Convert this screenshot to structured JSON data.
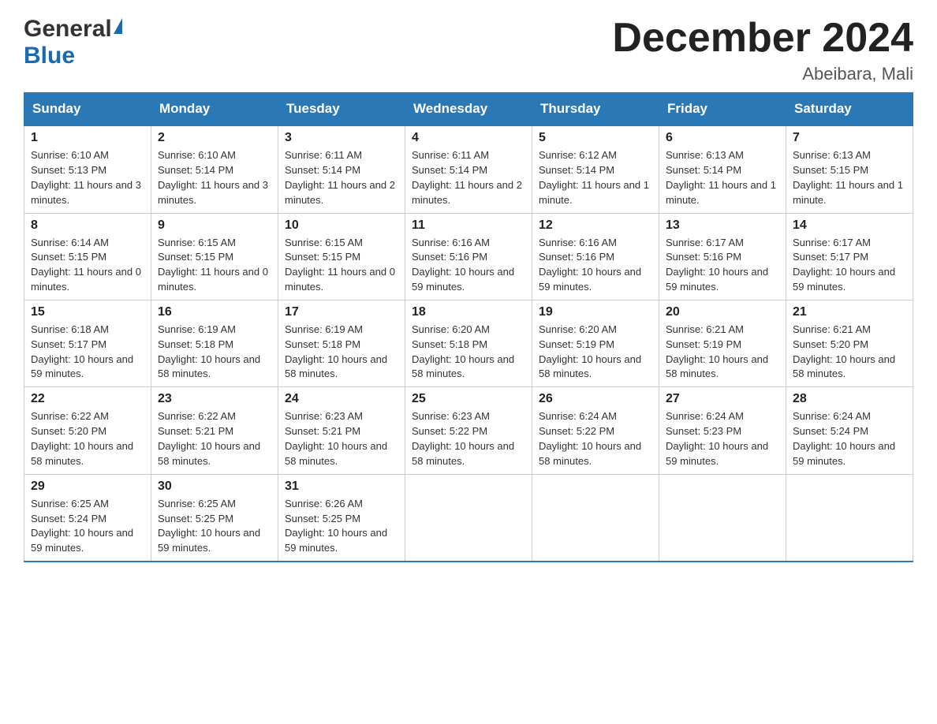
{
  "header": {
    "logo_general": "General",
    "logo_blue": "Blue",
    "month_title": "December 2024",
    "location": "Abeibara, Mali"
  },
  "columns": [
    "Sunday",
    "Monday",
    "Tuesday",
    "Wednesday",
    "Thursday",
    "Friday",
    "Saturday"
  ],
  "weeks": [
    [
      {
        "day": "1",
        "sunrise": "Sunrise: 6:10 AM",
        "sunset": "Sunset: 5:13 PM",
        "daylight": "Daylight: 11 hours and 3 minutes."
      },
      {
        "day": "2",
        "sunrise": "Sunrise: 6:10 AM",
        "sunset": "Sunset: 5:14 PM",
        "daylight": "Daylight: 11 hours and 3 minutes."
      },
      {
        "day": "3",
        "sunrise": "Sunrise: 6:11 AM",
        "sunset": "Sunset: 5:14 PM",
        "daylight": "Daylight: 11 hours and 2 minutes."
      },
      {
        "day": "4",
        "sunrise": "Sunrise: 6:11 AM",
        "sunset": "Sunset: 5:14 PM",
        "daylight": "Daylight: 11 hours and 2 minutes."
      },
      {
        "day": "5",
        "sunrise": "Sunrise: 6:12 AM",
        "sunset": "Sunset: 5:14 PM",
        "daylight": "Daylight: 11 hours and 1 minute."
      },
      {
        "day": "6",
        "sunrise": "Sunrise: 6:13 AM",
        "sunset": "Sunset: 5:14 PM",
        "daylight": "Daylight: 11 hours and 1 minute."
      },
      {
        "day": "7",
        "sunrise": "Sunrise: 6:13 AM",
        "sunset": "Sunset: 5:15 PM",
        "daylight": "Daylight: 11 hours and 1 minute."
      }
    ],
    [
      {
        "day": "8",
        "sunrise": "Sunrise: 6:14 AM",
        "sunset": "Sunset: 5:15 PM",
        "daylight": "Daylight: 11 hours and 0 minutes."
      },
      {
        "day": "9",
        "sunrise": "Sunrise: 6:15 AM",
        "sunset": "Sunset: 5:15 PM",
        "daylight": "Daylight: 11 hours and 0 minutes."
      },
      {
        "day": "10",
        "sunrise": "Sunrise: 6:15 AM",
        "sunset": "Sunset: 5:15 PM",
        "daylight": "Daylight: 11 hours and 0 minutes."
      },
      {
        "day": "11",
        "sunrise": "Sunrise: 6:16 AM",
        "sunset": "Sunset: 5:16 PM",
        "daylight": "Daylight: 10 hours and 59 minutes."
      },
      {
        "day": "12",
        "sunrise": "Sunrise: 6:16 AM",
        "sunset": "Sunset: 5:16 PM",
        "daylight": "Daylight: 10 hours and 59 minutes."
      },
      {
        "day": "13",
        "sunrise": "Sunrise: 6:17 AM",
        "sunset": "Sunset: 5:16 PM",
        "daylight": "Daylight: 10 hours and 59 minutes."
      },
      {
        "day": "14",
        "sunrise": "Sunrise: 6:17 AM",
        "sunset": "Sunset: 5:17 PM",
        "daylight": "Daylight: 10 hours and 59 minutes."
      }
    ],
    [
      {
        "day": "15",
        "sunrise": "Sunrise: 6:18 AM",
        "sunset": "Sunset: 5:17 PM",
        "daylight": "Daylight: 10 hours and 59 minutes."
      },
      {
        "day": "16",
        "sunrise": "Sunrise: 6:19 AM",
        "sunset": "Sunset: 5:18 PM",
        "daylight": "Daylight: 10 hours and 58 minutes."
      },
      {
        "day": "17",
        "sunrise": "Sunrise: 6:19 AM",
        "sunset": "Sunset: 5:18 PM",
        "daylight": "Daylight: 10 hours and 58 minutes."
      },
      {
        "day": "18",
        "sunrise": "Sunrise: 6:20 AM",
        "sunset": "Sunset: 5:18 PM",
        "daylight": "Daylight: 10 hours and 58 minutes."
      },
      {
        "day": "19",
        "sunrise": "Sunrise: 6:20 AM",
        "sunset": "Sunset: 5:19 PM",
        "daylight": "Daylight: 10 hours and 58 minutes."
      },
      {
        "day": "20",
        "sunrise": "Sunrise: 6:21 AM",
        "sunset": "Sunset: 5:19 PM",
        "daylight": "Daylight: 10 hours and 58 minutes."
      },
      {
        "day": "21",
        "sunrise": "Sunrise: 6:21 AM",
        "sunset": "Sunset: 5:20 PM",
        "daylight": "Daylight: 10 hours and 58 minutes."
      }
    ],
    [
      {
        "day": "22",
        "sunrise": "Sunrise: 6:22 AM",
        "sunset": "Sunset: 5:20 PM",
        "daylight": "Daylight: 10 hours and 58 minutes."
      },
      {
        "day": "23",
        "sunrise": "Sunrise: 6:22 AM",
        "sunset": "Sunset: 5:21 PM",
        "daylight": "Daylight: 10 hours and 58 minutes."
      },
      {
        "day": "24",
        "sunrise": "Sunrise: 6:23 AM",
        "sunset": "Sunset: 5:21 PM",
        "daylight": "Daylight: 10 hours and 58 minutes."
      },
      {
        "day": "25",
        "sunrise": "Sunrise: 6:23 AM",
        "sunset": "Sunset: 5:22 PM",
        "daylight": "Daylight: 10 hours and 58 minutes."
      },
      {
        "day": "26",
        "sunrise": "Sunrise: 6:24 AM",
        "sunset": "Sunset: 5:22 PM",
        "daylight": "Daylight: 10 hours and 58 minutes."
      },
      {
        "day": "27",
        "sunrise": "Sunrise: 6:24 AM",
        "sunset": "Sunset: 5:23 PM",
        "daylight": "Daylight: 10 hours and 59 minutes."
      },
      {
        "day": "28",
        "sunrise": "Sunrise: 6:24 AM",
        "sunset": "Sunset: 5:24 PM",
        "daylight": "Daylight: 10 hours and 59 minutes."
      }
    ],
    [
      {
        "day": "29",
        "sunrise": "Sunrise: 6:25 AM",
        "sunset": "Sunset: 5:24 PM",
        "daylight": "Daylight: 10 hours and 59 minutes."
      },
      {
        "day": "30",
        "sunrise": "Sunrise: 6:25 AM",
        "sunset": "Sunset: 5:25 PM",
        "daylight": "Daylight: 10 hours and 59 minutes."
      },
      {
        "day": "31",
        "sunrise": "Sunrise: 6:26 AM",
        "sunset": "Sunset: 5:25 PM",
        "daylight": "Daylight: 10 hours and 59 minutes."
      },
      null,
      null,
      null,
      null
    ]
  ]
}
